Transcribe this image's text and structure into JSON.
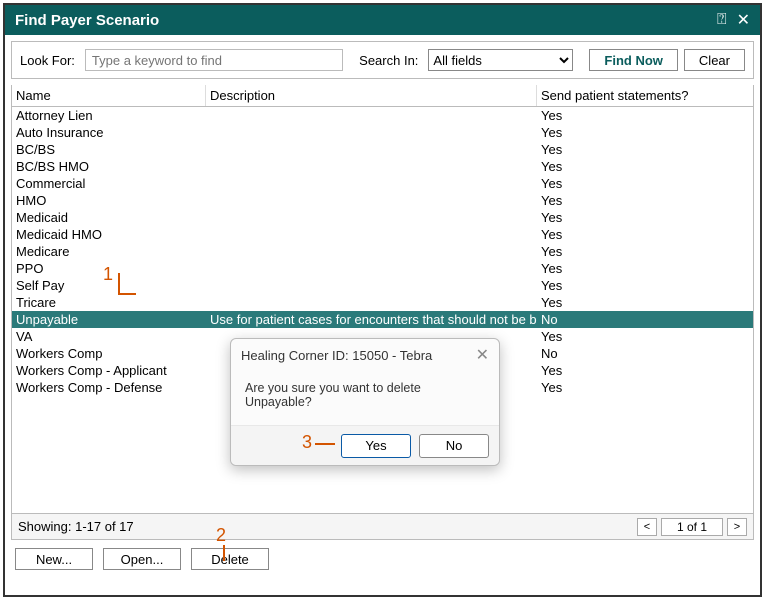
{
  "title": "Find Payer Scenario",
  "search": {
    "lookForLabel": "Look For:",
    "placeholder": "Type a keyword to find",
    "searchInLabel": "Search In:",
    "searchInValue": "All fields",
    "findNowLabel": "Find Now",
    "clearLabel": "Clear"
  },
  "columns": {
    "name": "Name",
    "description": "Description",
    "send": "Send patient statements?"
  },
  "rows": [
    {
      "name": "Attorney Lien",
      "description": "",
      "send": "Yes",
      "selected": false
    },
    {
      "name": "Auto Insurance",
      "description": "",
      "send": "Yes",
      "selected": false
    },
    {
      "name": "BC/BS",
      "description": "",
      "send": "Yes",
      "selected": false
    },
    {
      "name": "BC/BS HMO",
      "description": "",
      "send": "Yes",
      "selected": false
    },
    {
      "name": "Commercial",
      "description": "",
      "send": "Yes",
      "selected": false
    },
    {
      "name": "HMO",
      "description": "",
      "send": "Yes",
      "selected": false
    },
    {
      "name": "Medicaid",
      "description": "",
      "send": "Yes",
      "selected": false
    },
    {
      "name": "Medicaid HMO",
      "description": "",
      "send": "Yes",
      "selected": false
    },
    {
      "name": "Medicare",
      "description": "",
      "send": "Yes",
      "selected": false
    },
    {
      "name": "PPO",
      "description": "",
      "send": "Yes",
      "selected": false
    },
    {
      "name": "Self Pay",
      "description": "",
      "send": "Yes",
      "selected": false
    },
    {
      "name": "Tricare",
      "description": "",
      "send": "Yes",
      "selected": false
    },
    {
      "name": "Unpayable",
      "description": "Use for patient cases for encounters that should not be billed.",
      "send": "No",
      "selected": true
    },
    {
      "name": "VA",
      "description": "",
      "send": "Yes",
      "selected": false
    },
    {
      "name": "Workers Comp",
      "description": "",
      "send": "No",
      "selected": false
    },
    {
      "name": "Workers Comp - Applicant",
      "description": "",
      "send": "Yes",
      "selected": false
    },
    {
      "name": "Workers Comp - Defense",
      "description": "",
      "send": "Yes",
      "selected": false
    }
  ],
  "status": {
    "showing": "Showing: 1-17 of 17",
    "pagePrev": "<",
    "pageNext": ">",
    "pageValue": "1 of 1"
  },
  "bottom": {
    "new": "New...",
    "open": "Open...",
    "delete": "Delete"
  },
  "dialog": {
    "title": "Healing Corner ID: 15050 - Tebra",
    "message": "Are you sure you want to delete Unpayable?",
    "yes": "Yes",
    "no": "No"
  },
  "annotations": {
    "one": "1",
    "two": "2",
    "three": "3"
  }
}
